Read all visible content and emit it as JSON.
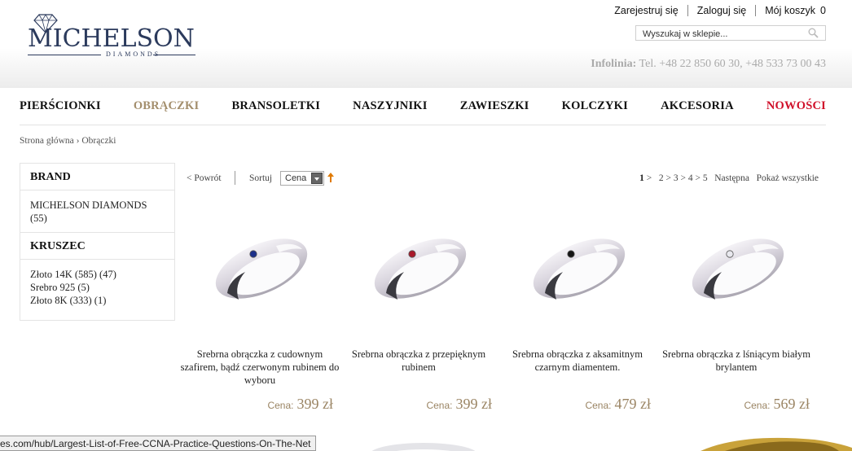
{
  "brand": {
    "main": "MICHELSON",
    "sub": "DIAMONDS"
  },
  "top_links": {
    "register": "Zarejestruj się",
    "login": "Zaloguj się",
    "cart": "Mój koszyk",
    "cart_count": "0"
  },
  "search": {
    "placeholder": "Wyszukaj w sklepie..."
  },
  "infoline": {
    "label": "Infolinia:",
    "phones": "Tel. +48 22 850 60 30, +48 533 73 00 43"
  },
  "nav": [
    "PIERŚCIONKI",
    "OBRĄCZKI",
    "BRANSOLETKI",
    "NASZYJNIKI",
    "ZAWIESZKI",
    "KOLCZYKI",
    "AKCESORIA",
    "NOWOŚCI"
  ],
  "breadcrumb": {
    "home": "Strona główna",
    "sep": "›",
    "current": "Obrączki"
  },
  "sidebar": {
    "brand_title": "BRAND",
    "brand_items": [
      "MICHELSON DIAMONDS (55)"
    ],
    "metal_title": "KRUSZEC",
    "metal_items": [
      "Złoto 14K (585) (47)",
      "Srebro 925 (5)",
      "Złoto 8K (333) (1)"
    ]
  },
  "toolbar": {
    "back": "< Powrót",
    "sort_label": "Sortuj",
    "sort_value": "Cena",
    "pages": [
      "1",
      "2",
      "3",
      "4",
      "5"
    ],
    "next": "Następna",
    "show_all": "Pokaż wszystkie"
  },
  "products": [
    {
      "name": "Srebrna obrączka z cudownym szafirem, bądź czerwonym rubinem do wyboru",
      "price_label": "Cena:",
      "price": "399 zł",
      "stone": "#1c2f8a"
    },
    {
      "name": "Srebrna obrączka z przepięknym rubinem",
      "price_label": "Cena:",
      "price": "399 zł",
      "stone": "#a8192a"
    },
    {
      "name": "Srebrna obrączka z aksamitnym czarnym diamentem.",
      "price_label": "Cena:",
      "price": "479 zł",
      "stone": "#141414"
    },
    {
      "name": "Srebrna obrączka z lśniącym białym brylantem",
      "price_label": "Cena:",
      "price": "569 zł",
      "stone": "#e8e8ee"
    }
  ],
  "status_url": "es.com/hub/Largest-List-of-Free-CCNA-Practice-Questions-On-The-Net",
  "colors": {
    "accent_gold": "#9a8463",
    "active_nav": "#a38e6c",
    "new_nav": "#d0102a",
    "brand_navy": "#2b3a5c"
  }
}
